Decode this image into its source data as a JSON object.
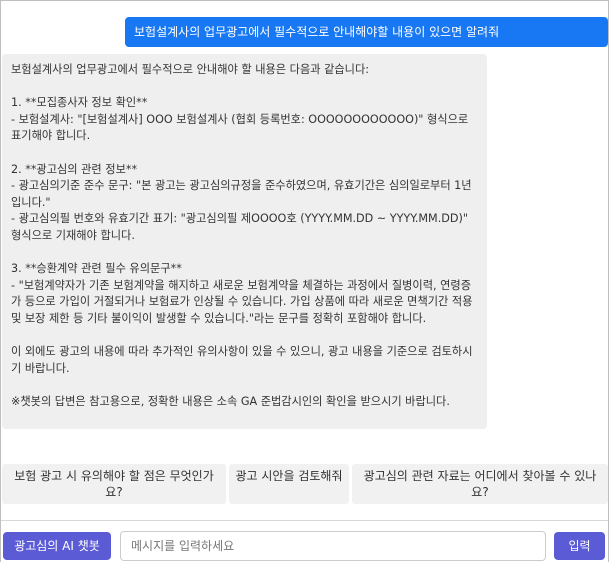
{
  "chat": {
    "user_message": "보험설계사의 업무광고에서 필수적으로 안내해야할 내용이 있으면 알려줘",
    "bot_message": "보험설계사의 업무광고에서 필수적으로 안내해야 할 내용은 다음과 같습니다:\n\n1. **모집종사자 정보 확인**\n- 보험설계사: \"[보험설계사] OOO 보험설계사 (협회 등록번호: OOOOOOOOOOOO)\" 형식으로 표기해야 합니다.\n\n2. **광고심의 관련 정보**\n- 광고심의기준 준수 문구: \"본 광고는 광고심의규정을 준수하였으며, 유효기간은 심의일로부터 1년입니다.\"\n- 광고심의필 번호와 유효기간 표기: \"광고심의필 제OOOO호 (YYYY.MM.DD ~ YYYY.MM.DD)\" 형식으로 기재해야 합니다.\n\n3. **승환계약 관련 필수 유의문구**\n- \"보험계약자가 기존 보험계약을 해지하고 새로운 보험계약을 체결하는 과정에서 질병이력, 연령증가 등으로 가입이 거절되거나 보험료가 인상될 수 있습니다. 가입 상품에 따라 새로운 면책기간 적용 및 보장 제한 등 기타 불이익이 발생할 수 있습니다.\"라는 문구를 정확히 포함해야 합니다.\n\n이 외에도 광고의 내용에 따라 추가적인 유의사항이 있을 수 있으니, 광고 내용을 기준으로 검토하시기 바랍니다.\n\n※챗봇의 답변은 참고용으로, 정확한 내용은 소속 GA 준법감시인의 확인을 받으시기 바랍니다."
  },
  "suggestions": [
    "보험 광고 시 유의해야 할 점은 무엇인가요?",
    "광고 시안을 검토해줘",
    "광고심의 관련 자료는 어디에서 찾아볼 수 있나요?"
  ],
  "input": {
    "bot_name_label": "광고심의 AI 챗봇",
    "placeholder": "메시지를 입력하세요",
    "value": "",
    "send_label": "입력"
  },
  "colors": {
    "user_bubble": "#1877f2",
    "bot_bubble": "#efefef",
    "button_accent": "#5b5bd6"
  }
}
